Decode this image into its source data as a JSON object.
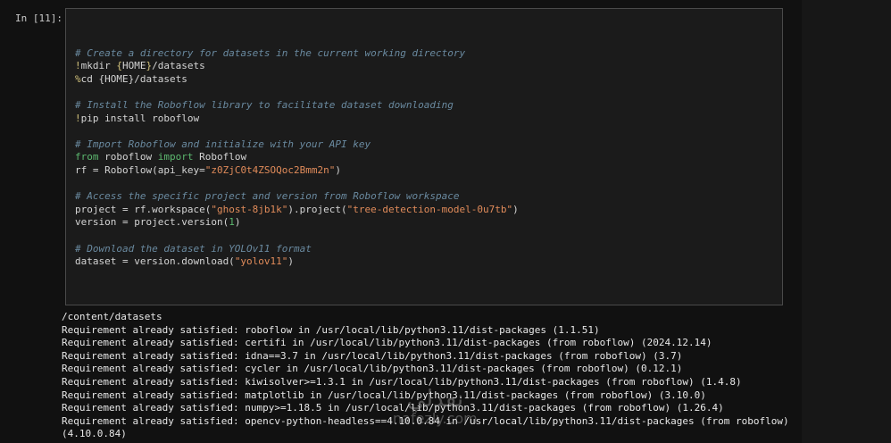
{
  "cell": {
    "prompt": "In [11]:",
    "code_lines": [
      [],
      [
        {
          "t": "# Create a directory for datasets in the current working directory",
          "c": "c"
        }
      ],
      [
        {
          "t": "!",
          "c": "m"
        },
        {
          "t": "mkdir ",
          "c": "v"
        },
        {
          "t": "{",
          "c": "m"
        },
        {
          "t": "HOME",
          "c": "v"
        },
        {
          "t": "}",
          "c": "m"
        },
        {
          "t": "/datasets",
          "c": "v"
        }
      ],
      [
        {
          "t": "%",
          "c": "m"
        },
        {
          "t": "cd ",
          "c": "v"
        },
        {
          "t": "{HOME}/datasets",
          "c": "v"
        }
      ],
      [],
      [
        {
          "t": "# Install the Roboflow library to facilitate dataset downloading",
          "c": "c"
        }
      ],
      [
        {
          "t": "!",
          "c": "m"
        },
        {
          "t": "pip install roboflow",
          "c": "v"
        }
      ],
      [],
      [
        {
          "t": "# Import Roboflow and initialize with your API key",
          "c": "c"
        }
      ],
      [
        {
          "t": "from",
          "c": "kw"
        },
        {
          "t": " roboflow ",
          "c": "v"
        },
        {
          "t": "import",
          "c": "kw"
        },
        {
          "t": " Roboflow",
          "c": "v"
        }
      ],
      [
        {
          "t": "rf = Roboflow(api_key=",
          "c": "v"
        },
        {
          "t": "\"z0ZjC0t4ZSOQoc2Bmm2n\"",
          "c": "s"
        },
        {
          "t": ")",
          "c": "v"
        }
      ],
      [],
      [
        {
          "t": "# Access the specific project and version from Roboflow workspace",
          "c": "c"
        }
      ],
      [
        {
          "t": "project = rf.workspace(",
          "c": "v"
        },
        {
          "t": "\"ghost-8jb1k\"",
          "c": "s"
        },
        {
          "t": ").project(",
          "c": "v"
        },
        {
          "t": "\"tree-detection-model-0u7tb\"",
          "c": "s"
        },
        {
          "t": ")",
          "c": "v"
        }
      ],
      [
        {
          "t": "version = project.version(",
          "c": "v"
        },
        {
          "t": "1",
          "c": "kw"
        },
        {
          "t": ")",
          "c": "v"
        }
      ],
      [],
      [
        {
          "t": "# Download the dataset in YOLOv11 format",
          "c": "c"
        }
      ],
      [
        {
          "t": "dataset = version.download(",
          "c": "v"
        },
        {
          "t": "\"yolov11\"",
          "c": "s"
        },
        {
          "t": ")",
          "c": "v"
        }
      ]
    ],
    "output_lines": [
      "/content/datasets",
      "Requirement already satisfied: roboflow in /usr/local/lib/python3.11/dist-packages (1.1.51)",
      "Requirement already satisfied: certifi in /usr/local/lib/python3.11/dist-packages (from roboflow) (2024.12.14)",
      "Requirement already satisfied: idna==3.7 in /usr/local/lib/python3.11/dist-packages (from roboflow) (3.7)",
      "Requirement already satisfied: cycler in /usr/local/lib/python3.11/dist-packages (from roboflow) (0.12.1)",
      "Requirement already satisfied: kiwisolver>=1.3.1 in /usr/local/lib/python3.11/dist-packages (from roboflow) (1.4.8)",
      "Requirement already satisfied: matplotlib in /usr/local/lib/python3.11/dist-packages (from roboflow) (3.10.0)",
      "Requirement already satisfied: numpy>=1.18.5 in /usr/local/lib/python3.11/dist-packages (from roboflow) (1.26.4)",
      "Requirement already satisfied: opencv-python-headless==4.10.0.84 in /usr/local/lib/python3.11/dist-packages (from roboflow)",
      "(4.10.0.84)"
    ]
  },
  "watermark": {
    "arabic": "نفذلي",
    "latin": "nafezly.com"
  },
  "colors": {
    "background": "#111111",
    "code_background": "#1b1b1b",
    "comment": "#6a8aa0",
    "magic": "#d3c37c",
    "keyword": "#5cb86f",
    "string": "#e08b5a"
  }
}
